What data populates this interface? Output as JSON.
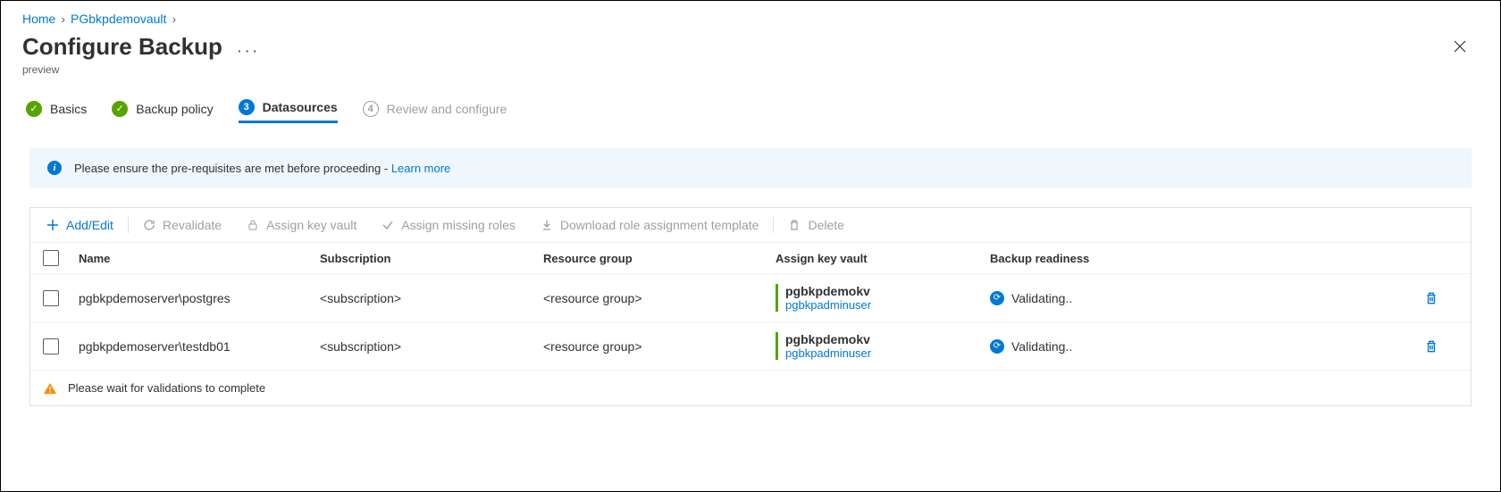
{
  "breadcrumb": {
    "home": "Home",
    "vault": "PGbkpdemovault"
  },
  "header": {
    "title": "Configure Backup",
    "subtitle": "preview"
  },
  "tabs": {
    "basics": "Basics",
    "policy": "Backup policy",
    "datasources": "Datasources",
    "review": "Review and configure",
    "step3": "3",
    "step4": "4"
  },
  "infobar": {
    "text": "Please ensure the pre-requisites are met before proceeding - ",
    "link": "Learn more"
  },
  "toolbar": {
    "add": "Add/Edit",
    "revalidate": "Revalidate",
    "assign_kv": "Assign key vault",
    "assign_roles": "Assign missing roles",
    "download": "Download role assignment template",
    "delete": "Delete"
  },
  "columns": {
    "name": "Name",
    "subscription": "Subscription",
    "rg": "Resource group",
    "kv": "Assign key vault",
    "readiness": "Backup readiness"
  },
  "rows": [
    {
      "name": "pgbkpdemoserver\\postgres",
      "subscription": "<subscription>",
      "rg": "<resource group>",
      "kv_name": "pgbkpdemokv",
      "kv_user": "pgbkpadminuser",
      "readiness": "Validating.."
    },
    {
      "name": "pgbkpdemoserver\\testdb01",
      "subscription": "<subscription>",
      "rg": "<resource group>",
      "kv_name": "pgbkpdemokv",
      "kv_user": "pgbkpadminuser",
      "readiness": "Validating.."
    }
  ],
  "footer": "Please wait for validations to complete"
}
